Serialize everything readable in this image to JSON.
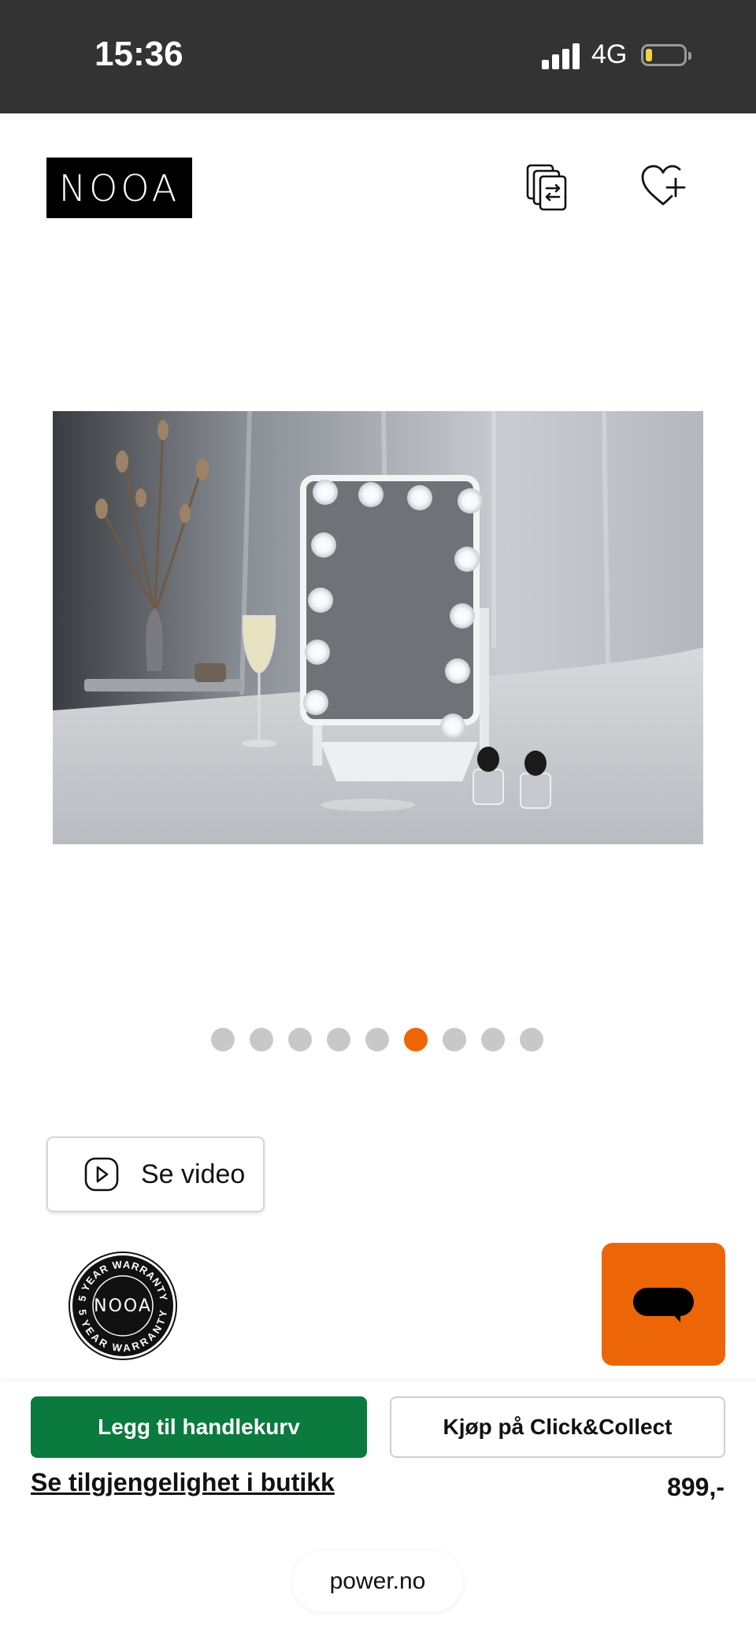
{
  "status_bar": {
    "time": "15:36",
    "network": "4G",
    "battery_level": 0.15,
    "signal_bars": 4
  },
  "header": {
    "logo_text": "NOOA",
    "icons": [
      "compare-icon",
      "wishlist-add-icon"
    ]
  },
  "gallery": {
    "image_count": 9,
    "active_index": 5,
    "active_color": "#ec6608",
    "inactive_color": "#c8c8c8"
  },
  "video_button": {
    "label": "Se video",
    "icon": "play-icon"
  },
  "warranty_badge": {
    "brand": "NOOA",
    "text": "5 YEAR WARRANTY"
  },
  "chat": {
    "icon": "chat-bubble-icon",
    "color": "#ec6608"
  },
  "actions": {
    "add_to_cart": "Legg til handlekurv",
    "add_to_cart_color": "#0a7a3f",
    "click_collect": "Kjøp på Click&Collect",
    "availability": "Se tilgjengelighet i butikk",
    "price": "899,-"
  },
  "browser": {
    "url": "power.no"
  }
}
